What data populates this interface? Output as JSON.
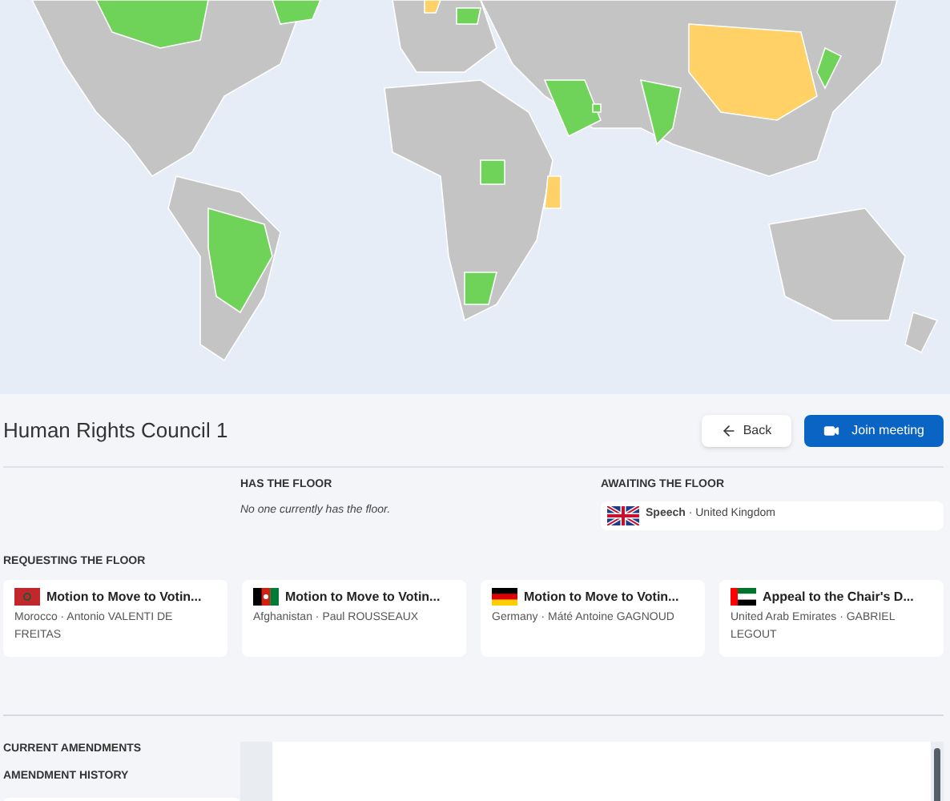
{
  "meeting": {
    "title": "Human Rights Council 1",
    "back_label": "Back",
    "join_label": "Join meeting"
  },
  "has_floor": {
    "heading": "HAS THE FLOOR",
    "empty_text": "No one currently has the floor."
  },
  "awaiting_floor": {
    "heading": "AWAITING THE FLOOR",
    "items": [
      {
        "kind": "uk",
        "text": "**Speech** · United Kingdom"
      }
    ]
  },
  "requesting_floor": {
    "heading": "REQUESTING THE FLOOR",
    "items": [
      {
        "kind": "morocco",
        "title": "Motion to Move to Votin...",
        "detail": "Morocco · Antonio VALENTI DE FREITAS"
      },
      {
        "kind": "afghanistan",
        "title": "Motion to Move to Votin...",
        "detail": "Afghanistan · Paul ROUSSEAUX"
      },
      {
        "kind": "germany",
        "title": "Motion to Move to Votin...",
        "detail": "Germany · Máté Antoine GAGNOUD"
      },
      {
        "kind": "uae",
        "title": "Appeal to the Chair's D...",
        "detail": "United Arab Emirates · GABRIEL LEGOUT"
      }
    ]
  },
  "amendments": {
    "current_heading": "CURRENT AMENDMENTS",
    "history_heading": "AMENDMENT HISTORY"
  }
}
